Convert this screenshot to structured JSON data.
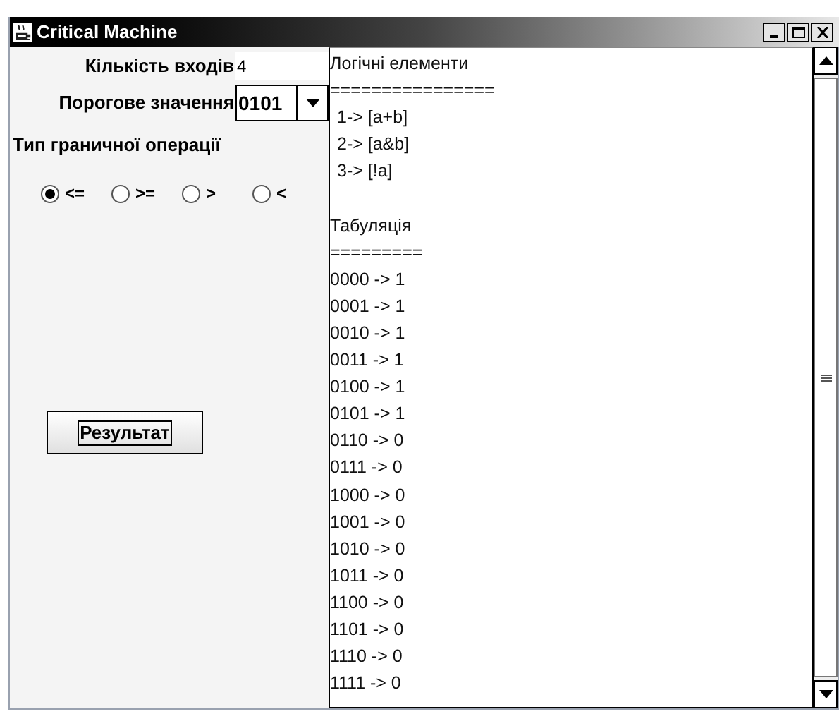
{
  "window": {
    "title": "Critical Machine"
  },
  "form": {
    "inputs_label": "Кількість входів",
    "inputs_value": "4",
    "threshold_label": "Порогове значення",
    "threshold_value": "0101",
    "operation_label": "Тип граничної операції",
    "operations": [
      {
        "label": "<=",
        "selected": true
      },
      {
        "label": ">=",
        "selected": false
      },
      {
        "label": ">",
        "selected": false
      },
      {
        "label": "<",
        "selected": false
      }
    ],
    "result_button": "Результат"
  },
  "output": {
    "lines": [
      {
        "kind": "text",
        "text": "Логічні елементи"
      },
      {
        "kind": "text",
        "text": "================"
      },
      {
        "kind": "item",
        "text": "1-> [a+b]"
      },
      {
        "kind": "item",
        "text": "2-> [a&b]"
      },
      {
        "kind": "item",
        "text": "3-> [!a]"
      },
      {
        "kind": "blank"
      },
      {
        "kind": "text",
        "text": "Табуляція"
      },
      {
        "kind": "text",
        "text": "========="
      },
      {
        "kind": "text",
        "text": "0000 -> 1"
      },
      {
        "kind": "text",
        "text": "0001 -> 1"
      },
      {
        "kind": "text",
        "text": "0010 -> 1"
      },
      {
        "kind": "text",
        "text": "0011 -> 1"
      },
      {
        "kind": "text",
        "text": "0100 -> 1"
      },
      {
        "kind": "text",
        "text": "0101 -> 1"
      },
      {
        "kind": "text",
        "text": "0110 -> 0"
      },
      {
        "kind": "text",
        "text": "0111 -> 0"
      },
      {
        "kind": "text",
        "text": "1000 -> 0"
      },
      {
        "kind": "text",
        "text": "1001 -> 0"
      },
      {
        "kind": "text",
        "text": "1010 -> 0"
      },
      {
        "kind": "text",
        "text": "1011 -> 0"
      },
      {
        "kind": "text",
        "text": "1100 -> 0"
      },
      {
        "kind": "text",
        "text": "1101 -> 0"
      },
      {
        "kind": "text",
        "text": "1110 -> 0"
      },
      {
        "kind": "text",
        "text": "1111 -> 0"
      }
    ]
  }
}
